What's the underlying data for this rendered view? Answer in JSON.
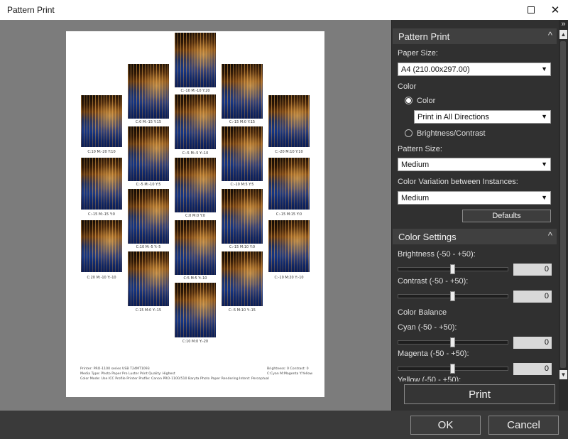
{
  "window": {
    "title": "Pattern Print"
  },
  "preview": {
    "thumbnails": [
      {
        "label": "C:10 M:-20 Y:10"
      },
      {
        "label": "C:-15 M:-15 Y:0"
      },
      {
        "label": "C:20 M:-10 Y:-10"
      },
      {
        "label": "C:0 M:-15 Y:15"
      },
      {
        "label": "C:-5 M:-10 Y:5"
      },
      {
        "label": "C:10 M:-5 Y:-5"
      },
      {
        "label": "C:15 M:0 Y:-15"
      },
      {
        "label": "C:-10 M:-10 Y:20"
      },
      {
        "label": "C:-5 M:-5 Y:-10"
      },
      {
        "label": "C:0 M:0 Y:0"
      },
      {
        "label": "C:5 M:5 Y:-10"
      },
      {
        "label": "C:10 M:0 Y:-20"
      },
      {
        "label": "C:-15 M:0 Y:15"
      },
      {
        "label": "C:-10 M:5 Y:5"
      },
      {
        "label": "C:-15 M:10 Y:0"
      },
      {
        "label": "C:-5 M:10 Y:-15"
      },
      {
        "label": "C:-20 M:10 Y:10"
      },
      {
        "label": "C:-15 M:15 Y:0"
      },
      {
        "label": "C:-10 M:20 Y:-10"
      }
    ],
    "footer": {
      "line1_left": "Printer: PRO-1100 series USB T24MT1093",
      "line2_left": "Media Type: Photo Paper Pro Luster    Print Quality: Highest",
      "line3_left": "Color Mode: Use ICC Profile    Printer Profile: Canon PRO-1100/510 Baryta Photo Paper    Rendering Intent: Perceptual",
      "line1_right": "Brightness: 0  Contrast: 0",
      "line2_right": "C:Cyan M:Magenta Y:Yellow"
    }
  },
  "panel": {
    "expand_glyph": "»",
    "pattern_print": {
      "header": "Pattern Print",
      "paper_size_label": "Paper Size:",
      "paper_size_value": "A4 (210.00x297.00)",
      "color_group_label": "Color",
      "color_radio_label": "Color",
      "color_direction_value": "Print in All Directions",
      "brightness_radio_label": "Brightness/Contrast",
      "pattern_size_label": "Pattern Size:",
      "pattern_size_value": "Medium",
      "variation_label": "Color Variation between Instances:",
      "variation_value": "Medium",
      "defaults_button": "Defaults"
    },
    "color_settings": {
      "header": "Color Settings",
      "brightness_label": "Brightness (-50 - +50):",
      "brightness_value": "0",
      "contrast_label": "Contrast (-50 - +50):",
      "contrast_value": "0",
      "balance_label": "Color Balance",
      "cyan_label": "Cyan (-50 - +50):",
      "cyan_value": "0",
      "magenta_label": "Magenta (-50 - +50):",
      "magenta_value": "0",
      "yellow_label": "Yellow (-50 - +50):"
    },
    "print_button": "Print"
  },
  "dialog": {
    "ok_label": "OK",
    "cancel_label": "Cancel"
  }
}
